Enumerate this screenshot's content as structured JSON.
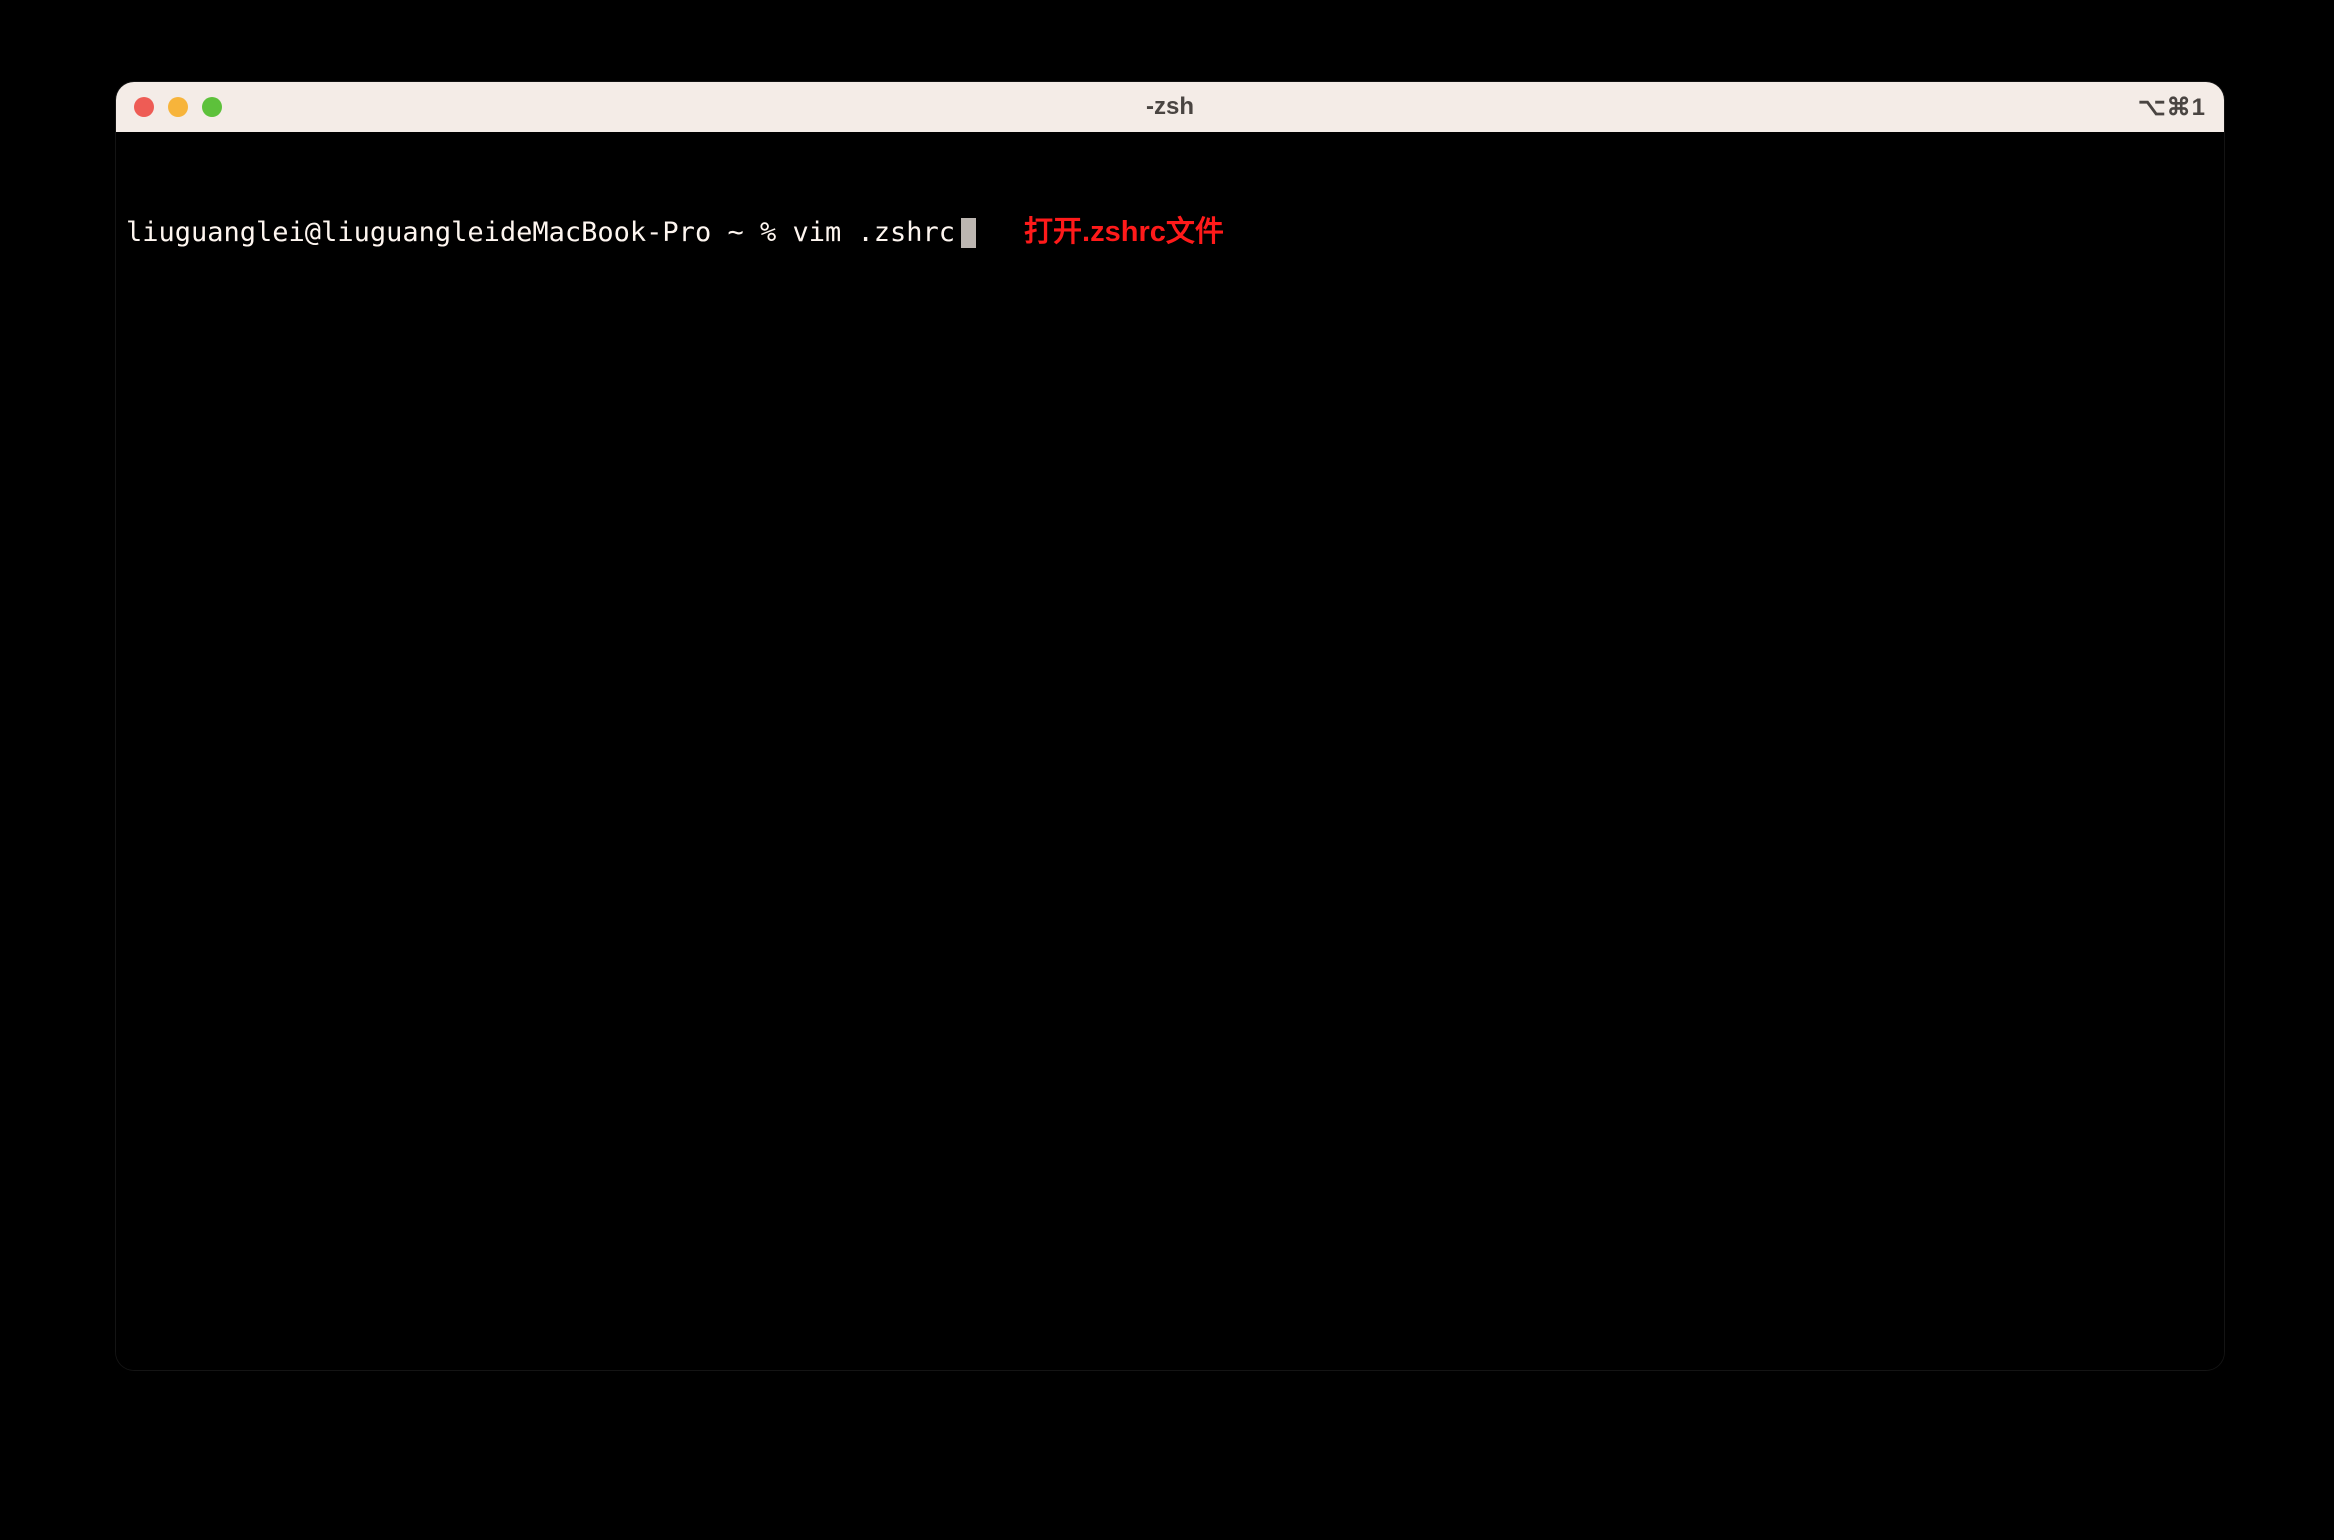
{
  "window": {
    "title": "-zsh",
    "tab_indicator": "⌥⌘1"
  },
  "terminal": {
    "prompt": "liuguanglei@liuguangleideMacBook-Pro ~ % ",
    "command": "vim .zshrc",
    "annotation": "打开.zshrc文件"
  }
}
